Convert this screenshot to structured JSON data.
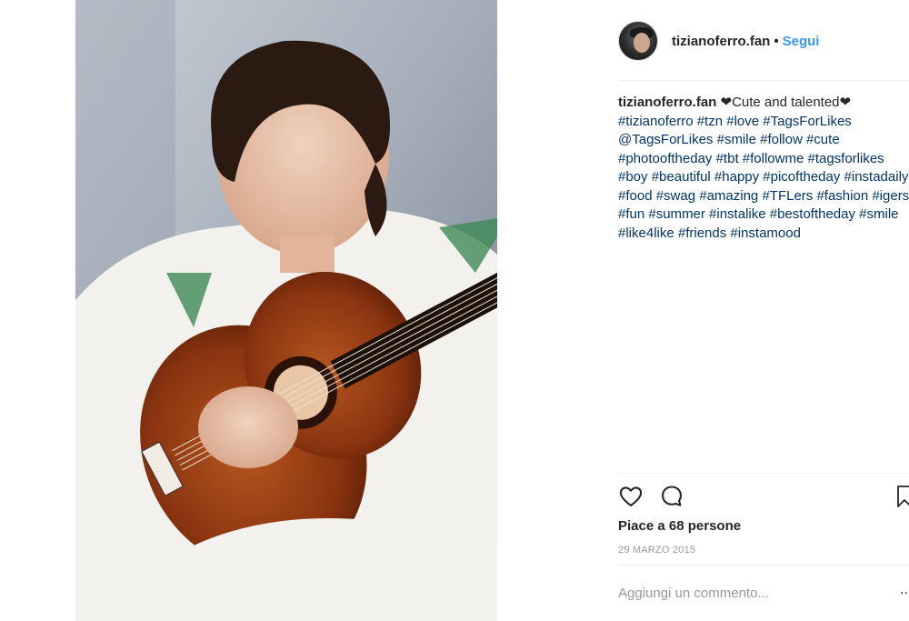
{
  "post": {
    "username": "tizianoferro.fan",
    "separator": "•",
    "follow_label": "Segui",
    "caption_text": "❤Cute and talented❤",
    "hashtags": "#tizianoferro #tzn #love #TagsForLikes @TagsForLikes #smile #follow #cute #photooftheday #tbt #followme #tagsforlikes #boy #beautiful #happy #picoftheday #instadaily #food #swag #amazing #TFLers #fashion #igers #fun #summer #instalike #bestoftheday #smile #like4like #friends #instamood",
    "likes": "Piace a 68 persone",
    "date": "29 MARZO 2015",
    "comment_placeholder": "Aggiungi un commento...",
    "more_options": "..."
  },
  "icons": {
    "like": "heart-outline-icon",
    "comment": "comment-bubble-icon",
    "save": "bookmark-icon"
  },
  "colors": {
    "link": "#3897f0",
    "hashtag": "#003569",
    "muted": "#999999",
    "text": "#262626"
  }
}
